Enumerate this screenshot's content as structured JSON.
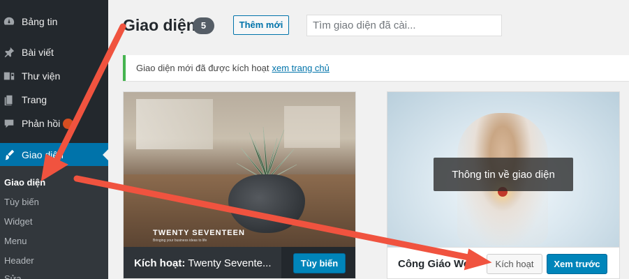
{
  "sidebar": {
    "items": [
      {
        "label": "Bảng tin",
        "icon": "dashboard-icon"
      },
      {
        "label": "Bài viết",
        "icon": "pin-icon"
      },
      {
        "label": "Thư viện",
        "icon": "media-icon"
      },
      {
        "label": "Trang",
        "icon": "page-icon"
      },
      {
        "label": "Phản hồi",
        "icon": "comment-icon"
      },
      {
        "label": "Giao diện",
        "icon": "brush-icon"
      }
    ],
    "submenu": [
      "Giao diện",
      "Tùy biến",
      "Widget",
      "Menu",
      "Header"
    ],
    "cut_item": "Sửa"
  },
  "header": {
    "title": "Giao diện",
    "count": "5",
    "add_new": "Thêm mới",
    "search_placeholder": "Tìm giao diện đã cài..."
  },
  "notice": {
    "text": "Giao diện mới đã được kích hoạt",
    "link": "xem trang chủ"
  },
  "themes": [
    {
      "active_prefix": "Kích hoạt:",
      "name": "Twenty Sevente...",
      "brand": "TWENTY SEVENTEEN",
      "brand_sub": "Bringing your business ideas to life",
      "customize": "Tùy biến"
    },
    {
      "name": "Công Giáo Wor",
      "overlay": "Thông tin về giao diện",
      "activate": "Kích hoạt",
      "preview": "Xem trước"
    }
  ],
  "colors": {
    "sidebar": "#23282d",
    "current": "#0073aa",
    "annotation_arrow": "#f0533f",
    "notice_border": "#46b450"
  }
}
